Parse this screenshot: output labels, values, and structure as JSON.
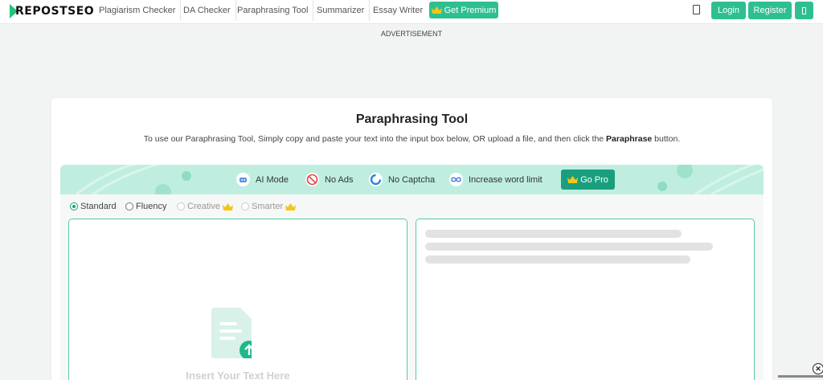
{
  "nav": {
    "logo_text": "REPOSTSEO",
    "links": [
      "Plagiarism Checker",
      "DA Checker",
      "Paraphrasing Tool",
      "Summarizer",
      "Essay Writer"
    ],
    "premium_label": "Get Premium",
    "login_label": "Login",
    "register_label": "Register"
  },
  "ad": {
    "label": "ADVERTISEMENT"
  },
  "main": {
    "title": "Paraphrasing Tool",
    "desc_before": "To use our Paraphrasing Tool, Simply copy and paste your text into the input box below, OR upload a file, and then click the ",
    "desc_bold": "Paraphrase",
    "desc_after": " button."
  },
  "features": {
    "items": [
      "AI Mode",
      "No Ads",
      "No Captcha",
      "Increase word limit"
    ],
    "gopro_label": "Go Pro"
  },
  "modes": {
    "items": [
      "Standard",
      "Fluency",
      "Creative",
      "Smarter"
    ],
    "selected": "Standard"
  },
  "input": {
    "placeholder": "Insert Your Text Here"
  },
  "colors": {
    "accent": "#2ebf91",
    "dark_accent": "#1a9f7e",
    "banner": "#bfeee0",
    "crown": "#f5c518"
  }
}
